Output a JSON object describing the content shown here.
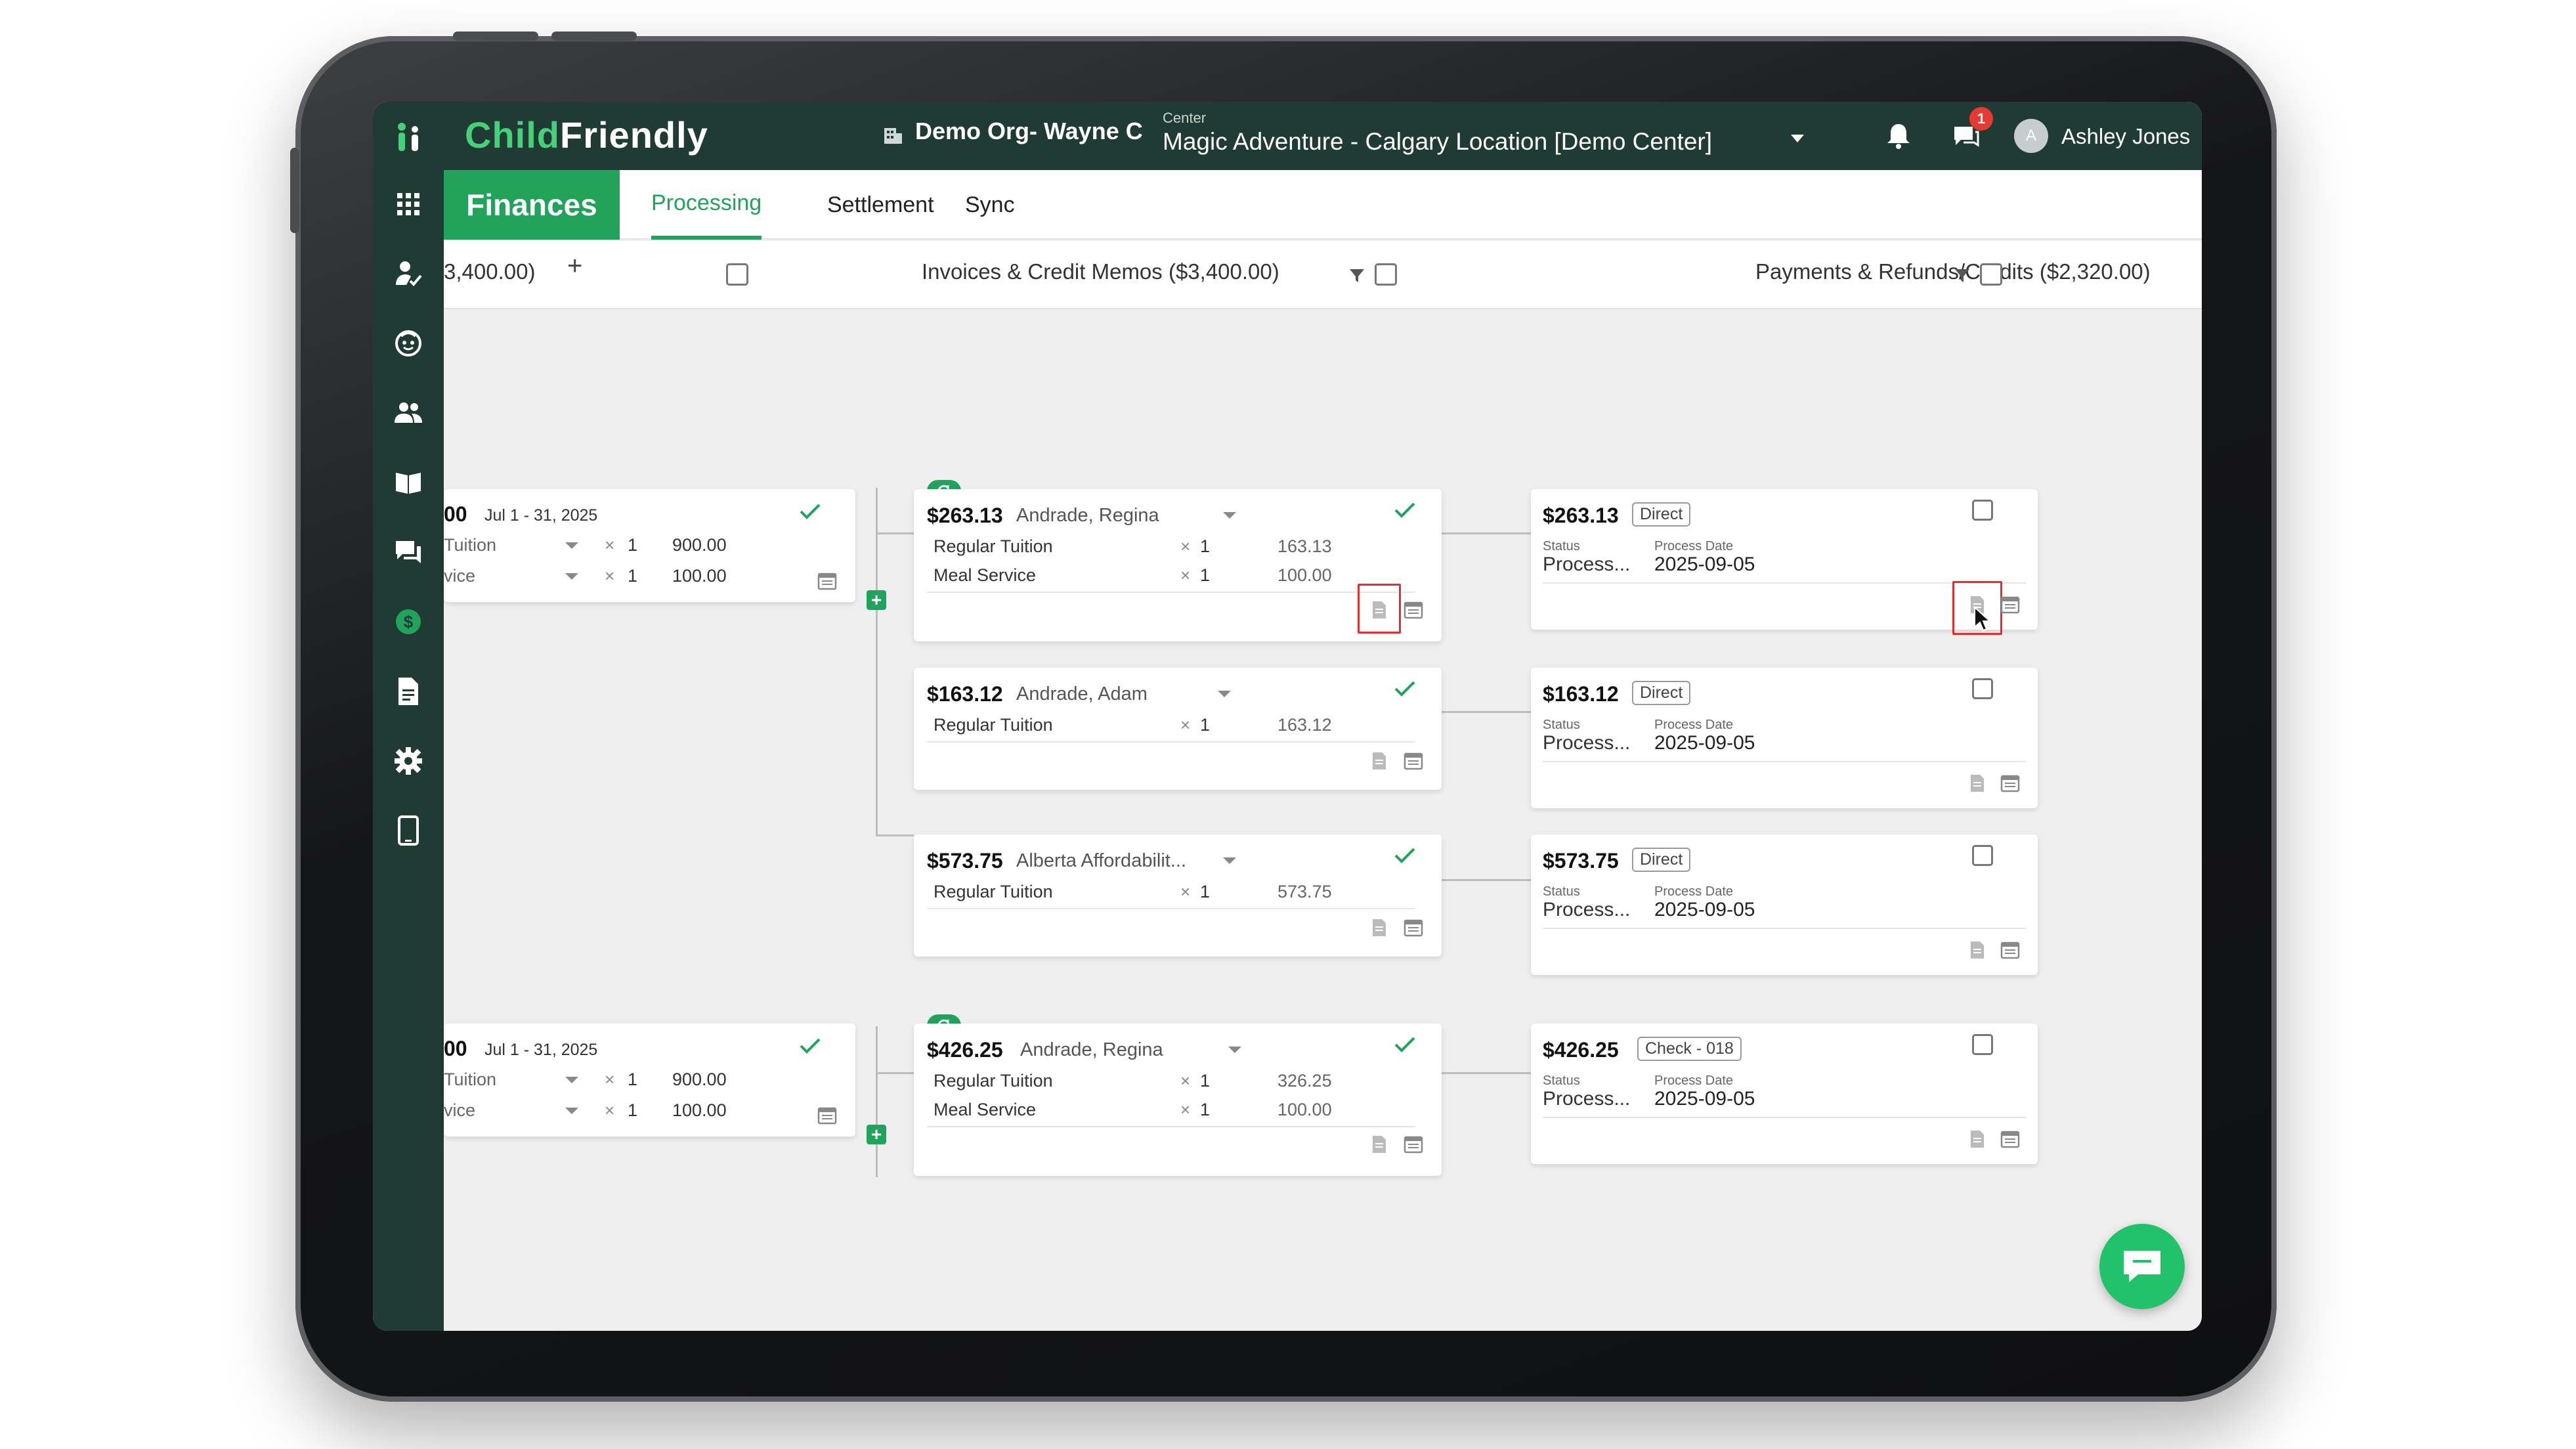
{
  "colors": {
    "brand": "#21a35c",
    "topbar": "#1f3b34",
    "alert": "#e53935"
  },
  "topbar": {
    "brand_a": "Child",
    "brand_b": "Friendly",
    "org": "Demo Org- Wayne C",
    "center_label": "Center",
    "center_value": "Magic Adventure - Calgary Location [Demo Center]",
    "notification_badge": "1",
    "user_initial": "A",
    "user_name": "Ashley Jones"
  },
  "sidebar": {
    "items": [
      "apps-grid-icon",
      "child-check-in-icon",
      "child-face-icon",
      "families-icon",
      "curriculum-book-icon",
      "messages-icon",
      "finances-dollar-icon",
      "documents-icon",
      "settings-gear-icon",
      "tablet-icon"
    ],
    "active": "finances-dollar-icon"
  },
  "tabs": {
    "module": "Finances",
    "items": [
      {
        "label": "Processing",
        "active": true
      },
      {
        "label": "Settlement",
        "active": false
      },
      {
        "label": "Sync",
        "active": false
      }
    ]
  },
  "columns": {
    "left": "3,400.00)",
    "invoices": "Invoices & Credit Memos ($3,400.00)",
    "payments": "Payments & Refunds/Credits ($2,320.00)"
  },
  "left_cards": [
    {
      "amount": "00",
      "period": "Jul 1 - 31, 2025",
      "lines": [
        {
          "label": "Tuition",
          "qty": "1",
          "value": "900.00"
        },
        {
          "label": "vice",
          "qty": "1",
          "value": "100.00"
        }
      ]
    },
    {
      "amount": "00",
      "period": "Jul 1 - 31, 2025",
      "lines": [
        {
          "label": "Tuition",
          "qty": "1",
          "value": "900.00"
        },
        {
          "label": "vice",
          "qty": "1",
          "value": "100.00"
        }
      ]
    }
  ],
  "invoices": [
    {
      "amount": "$263.13",
      "name": "Andrade, Regina",
      "lines": [
        {
          "label": "Regular Tuition",
          "qty": "1",
          "value": "163.13"
        },
        {
          "label": "Meal Service",
          "qty": "1",
          "value": "100.00"
        }
      ]
    },
    {
      "amount": "$163.12",
      "name": "Andrade, Adam",
      "lines": [
        {
          "label": "Regular Tuition",
          "qty": "1",
          "value": "163.12"
        }
      ]
    },
    {
      "amount": "$573.75",
      "name": "Alberta Affordabilit...",
      "lines": [
        {
          "label": "Regular Tuition",
          "qty": "1",
          "value": "573.75"
        }
      ]
    },
    {
      "amount": "$426.25",
      "name": "Andrade, Regina",
      "lines": [
        {
          "label": "Regular Tuition",
          "qty": "1",
          "value": "326.25"
        },
        {
          "label": "Meal Service",
          "qty": "1",
          "value": "100.00"
        }
      ]
    }
  ],
  "payments": [
    {
      "amount": "$263.13",
      "method": "Direct",
      "status_label": "Status",
      "status": "Process...",
      "date_label": "Process Date",
      "date": "2025-09-05"
    },
    {
      "amount": "$163.12",
      "method": "Direct",
      "status_label": "Status",
      "status": "Process...",
      "date_label": "Process Date",
      "date": "2025-09-05"
    },
    {
      "amount": "$573.75",
      "method": "Direct",
      "status_label": "Status",
      "status": "Process...",
      "date_label": "Process Date",
      "date": "2025-09-05"
    },
    {
      "amount": "$426.25",
      "method": "Check - 018",
      "status_label": "Status",
      "status": "Process...",
      "date_label": "Process Date",
      "date": "2025-09-05"
    }
  ],
  "glyphs": {
    "times": "×",
    "plus": "+"
  }
}
